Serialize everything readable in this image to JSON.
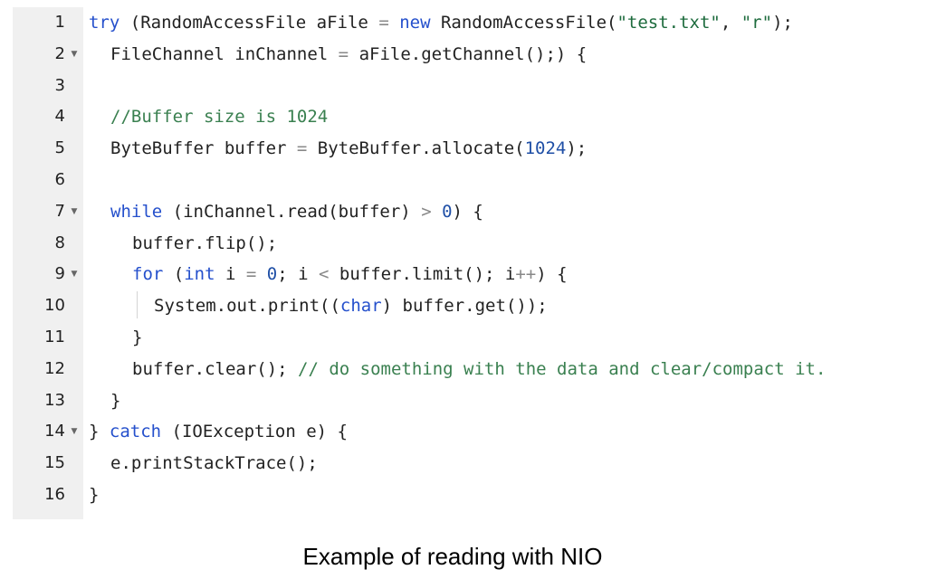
{
  "caption": "Example of reading with NIO",
  "colors": {
    "gutter_bg": "#f0f0f0",
    "keyword": "#2550cc",
    "string": "#1d6b3d",
    "number": "#1f4fa6",
    "comment": "#3a8050",
    "operator": "#888888",
    "text": "#222222"
  },
  "fold_icon": "chevron-down-icon",
  "lines": [
    {
      "n": "1",
      "fold": false,
      "indent": 0,
      "tokens": [
        {
          "t": "kw",
          "v": "try"
        },
        {
          "t": "pl",
          "v": " (RandomAccessFile aFile "
        },
        {
          "t": "op",
          "v": "="
        },
        {
          "t": "pl",
          "v": " "
        },
        {
          "t": "kw",
          "v": "new"
        },
        {
          "t": "pl",
          "v": " RandomAccessFile("
        },
        {
          "t": "str",
          "v": "\"test.txt\""
        },
        {
          "t": "pl",
          "v": ", "
        },
        {
          "t": "str",
          "v": "\"r\""
        },
        {
          "t": "pl",
          "v": ");"
        }
      ]
    },
    {
      "n": "2",
      "fold": true,
      "indent": 1,
      "tokens": [
        {
          "t": "pl",
          "v": "FileChannel inChannel "
        },
        {
          "t": "op",
          "v": "="
        },
        {
          "t": "pl",
          "v": " aFile.getChannel();) {"
        }
      ]
    },
    {
      "n": "3",
      "fold": false,
      "indent": 0,
      "tokens": []
    },
    {
      "n": "4",
      "fold": false,
      "indent": 1,
      "tokens": [
        {
          "t": "com",
          "v": "//Buffer size is 1024"
        }
      ]
    },
    {
      "n": "5",
      "fold": false,
      "indent": 1,
      "tokens": [
        {
          "t": "pl",
          "v": "ByteBuffer buffer "
        },
        {
          "t": "op",
          "v": "="
        },
        {
          "t": "pl",
          "v": " ByteBuffer.allocate("
        },
        {
          "t": "num",
          "v": "1024"
        },
        {
          "t": "pl",
          "v": ");"
        }
      ]
    },
    {
      "n": "6",
      "fold": false,
      "indent": 0,
      "tokens": []
    },
    {
      "n": "7",
      "fold": true,
      "indent": 1,
      "tokens": [
        {
          "t": "kw",
          "v": "while"
        },
        {
          "t": "pl",
          "v": " (inChannel.read(buffer) "
        },
        {
          "t": "op",
          "v": ">"
        },
        {
          "t": "pl",
          "v": " "
        },
        {
          "t": "num",
          "v": "0"
        },
        {
          "t": "pl",
          "v": ") {"
        }
      ]
    },
    {
      "n": "8",
      "fold": false,
      "indent": 2,
      "tokens": [
        {
          "t": "pl",
          "v": "buffer.flip();"
        }
      ]
    },
    {
      "n": "9",
      "fold": true,
      "indent": 2,
      "tokens": [
        {
          "t": "kw",
          "v": "for"
        },
        {
          "t": "pl",
          "v": " ("
        },
        {
          "t": "kw",
          "v": "int"
        },
        {
          "t": "pl",
          "v": " i "
        },
        {
          "t": "op",
          "v": "="
        },
        {
          "t": "pl",
          "v": " "
        },
        {
          "t": "num",
          "v": "0"
        },
        {
          "t": "pl",
          "v": "; i "
        },
        {
          "t": "op",
          "v": "<"
        },
        {
          "t": "pl",
          "v": " buffer.limit(); i"
        },
        {
          "t": "op",
          "v": "++"
        },
        {
          "t": "pl",
          "v": ") {"
        }
      ]
    },
    {
      "n": "10",
      "fold": false,
      "indent": 3,
      "tokens": [
        {
          "t": "pl",
          "v": "System.out.print(("
        },
        {
          "t": "kw",
          "v": "char"
        },
        {
          "t": "pl",
          "v": ") buffer.get());"
        }
      ]
    },
    {
      "n": "11",
      "fold": false,
      "indent": 2,
      "tokens": [
        {
          "t": "pl",
          "v": "}"
        }
      ]
    },
    {
      "n": "12",
      "fold": false,
      "indent": 2,
      "tokens": [
        {
          "t": "pl",
          "v": "buffer.clear(); "
        },
        {
          "t": "com",
          "v": "// do something with the data and clear/compact it."
        }
      ]
    },
    {
      "n": "13",
      "fold": false,
      "indent": 1,
      "tokens": [
        {
          "t": "pl",
          "v": "}"
        }
      ]
    },
    {
      "n": "14",
      "fold": true,
      "indent": 0,
      "tokens": [
        {
          "t": "pl",
          "v": "} "
        },
        {
          "t": "kw",
          "v": "catch"
        },
        {
          "t": "pl",
          "v": " (IOException e) {"
        }
      ]
    },
    {
      "n": "15",
      "fold": false,
      "indent": 1,
      "tokens": [
        {
          "t": "pl",
          "v": "e.printStackTrace();"
        }
      ]
    },
    {
      "n": "16",
      "fold": false,
      "indent": 0,
      "tokens": [
        {
          "t": "pl",
          "v": "}"
        }
      ]
    }
  ]
}
